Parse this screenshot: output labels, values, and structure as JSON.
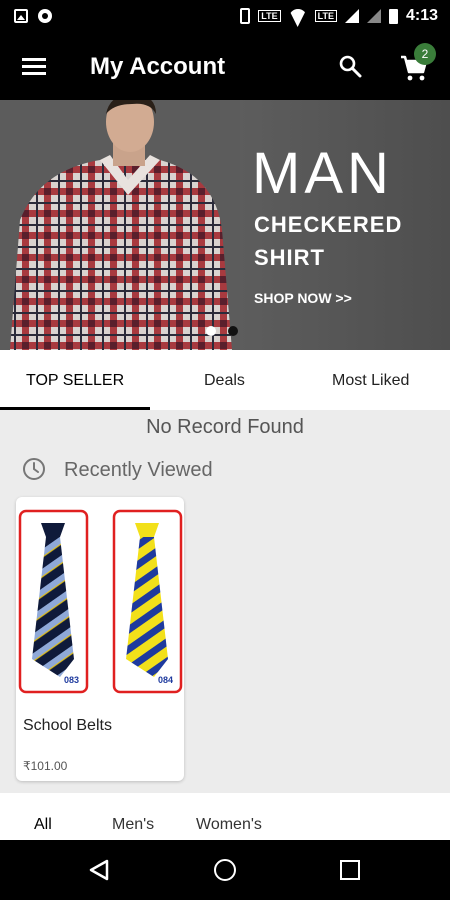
{
  "status_bar": {
    "time": "4:13",
    "lte1": "LTE",
    "lte2": "LTE",
    "icons": [
      "image-icon",
      "circle-icon",
      "vibrate-icon",
      "volte-icon",
      "wifi-icon",
      "signal-icon",
      "signal-icon",
      "battery-icon"
    ]
  },
  "appbar": {
    "title": "My Account",
    "cart_count": "2"
  },
  "banner": {
    "title": "MAN",
    "subtitle_line1": "CHECKERED",
    "subtitle_line2": "SHIRT",
    "cta": "SHOP NOW >>",
    "slides": 2,
    "active_slide": 2
  },
  "tabs": {
    "items": [
      {
        "label": "TOP SELLER",
        "active": true
      },
      {
        "label": "Deals",
        "active": false
      },
      {
        "label": "Most Liked",
        "active": false
      }
    ]
  },
  "top_seller": {
    "empty_message": "No Record Found"
  },
  "recently_viewed": {
    "title": "Recently Viewed",
    "products": [
      {
        "name": "School Belts",
        "price": "₹101.00",
        "variants": [
          "083",
          "084"
        ]
      }
    ]
  },
  "bottom_tabs": {
    "items": [
      {
        "label": "All",
        "active": true
      },
      {
        "label": "Men's",
        "active": false
      },
      {
        "label": "Women's",
        "active": false
      }
    ]
  },
  "colors": {
    "appbar": "#000000",
    "badge": "#3a7d3a",
    "highlight_border": "#e02020",
    "tie_navy": "#0f1a3a",
    "tie_light_blue": "#8fa9d8",
    "tie_yellow": "#f2e01a",
    "tie_blue": "#1e3a9e"
  }
}
